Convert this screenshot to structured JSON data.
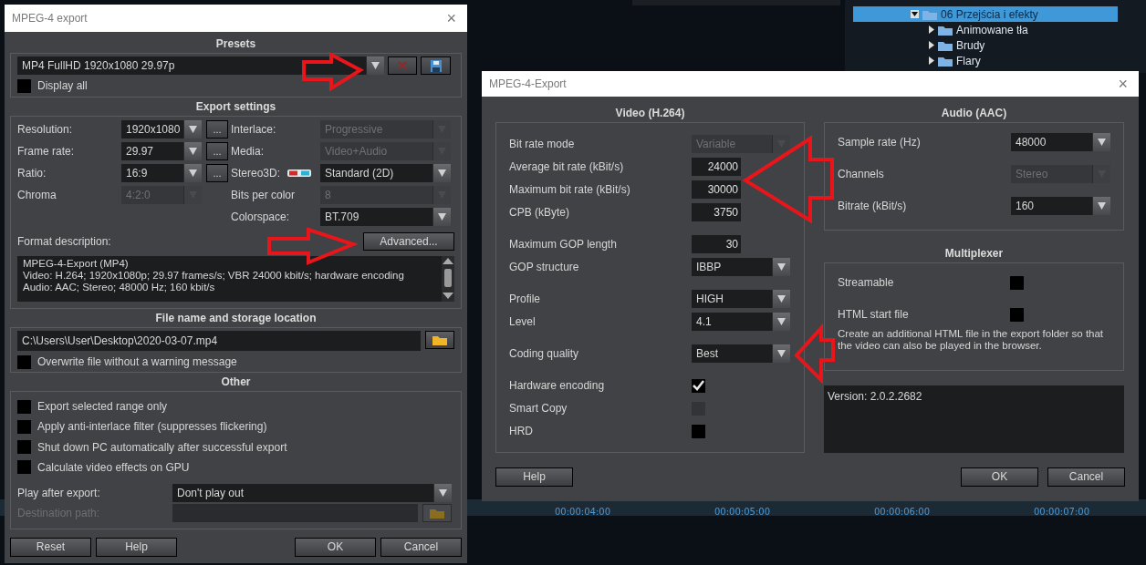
{
  "background": {
    "tree": {
      "items": [
        {
          "label": "06 Przejścia i efekty",
          "selected": true,
          "expanded": true,
          "children": [
            {
              "label": "Animowane tła",
              "selected": false
            },
            {
              "label": "Brudy",
              "selected": false
            },
            {
              "label": "Flary",
              "selected": false
            }
          ]
        }
      ]
    },
    "timeline": {
      "labels": [
        "00:00:04:00",
        "00:00:05:00",
        "00:00:06:00",
        "00:00:07:00"
      ]
    }
  },
  "export_dialog": {
    "title": "MPEG-4 export",
    "close": "×",
    "presets": {
      "title": "Presets",
      "preset": "MP4 FullHD 1920x1080 29.97p",
      "display_all": {
        "label": "Display all",
        "checked": false
      }
    },
    "export_settings": {
      "title": "Export settings",
      "left": [
        {
          "label": "Resolution:",
          "value": "1920x1080",
          "disabled": false,
          "more": "..."
        },
        {
          "label": "Frame rate:",
          "value": "29.97",
          "disabled": false,
          "more": "..."
        },
        {
          "label": "Ratio:",
          "value": "16:9",
          "disabled": false,
          "more": "..."
        },
        {
          "label": "Chroma",
          "value": "4:2:0",
          "disabled": true
        }
      ],
      "right": [
        {
          "label": "Interlace:",
          "value": "Progressive",
          "disabled": true,
          "kind": "select"
        },
        {
          "label": "Media:",
          "value": "Video+Audio",
          "disabled": true,
          "kind": "select"
        },
        {
          "label": "Stereo3D:",
          "value": "Standard (2D)",
          "disabled": false,
          "kind": "stereo"
        },
        {
          "label": "Bits per color",
          "value": "8",
          "disabled": true,
          "kind": "select"
        },
        {
          "label": "Colorspace:",
          "value": "BT.709",
          "disabled": false,
          "kind": "select"
        }
      ],
      "format_label": "Format description:",
      "advanced_button": "Advanced...",
      "description": [
        "MPEG-4-Export (MP4)",
        "Video: H.264; 1920x1080p; 29.97 frames/s; VBR 24000 kbit/s; hardware encoding",
        "Audio: AAC; Stereo; 48000 Hz; 160 kbit/s"
      ]
    },
    "file": {
      "title": "File name and storage location",
      "path": "C:\\Users\\User\\Desktop\\2020-03-07.mp4",
      "overwrite": {
        "label": "Overwrite file without a warning message",
        "checked": false
      }
    },
    "other": {
      "title": "Other",
      "options": [
        {
          "label": "Export selected range only",
          "checked": false
        },
        {
          "label": "Apply anti-interlace filter (suppresses flickering)",
          "checked": false
        },
        {
          "label": "Shut down PC automatically after successful export",
          "checked": false
        },
        {
          "label": "Calculate video effects on GPU",
          "checked": false
        }
      ],
      "play_label": "Play after export:",
      "play_value": "Don't play out",
      "destination_label": "Destination path:",
      "destination_disabled": true
    },
    "buttons": [
      "Reset",
      "Help",
      "OK",
      "Cancel"
    ]
  },
  "advanced_dialog": {
    "title": "MPEG-4-Export",
    "close": "×",
    "video": {
      "title": "Video (H.264)",
      "groups": [
        [
          {
            "label": "Bit rate mode",
            "kind": "select",
            "value": "Variable",
            "disabled": true
          },
          {
            "label": "Average bit rate (kBit/s)",
            "kind": "input",
            "value": "24000"
          },
          {
            "label": "Maximum bit rate (kBit/s)",
            "kind": "input",
            "value": "30000"
          },
          {
            "label": "CPB (kByte)",
            "kind": "input",
            "value": "3750"
          }
        ],
        [
          {
            "label": "Maximum GOP length",
            "kind": "input",
            "value": "30"
          },
          {
            "label": "GOP structure",
            "kind": "select",
            "value": "IBBP",
            "disabled": false
          }
        ],
        [
          {
            "label": "Profile",
            "kind": "select",
            "value": "HIGH",
            "disabled": false
          },
          {
            "label": "Level",
            "kind": "select",
            "value": "4.1",
            "disabled": false
          }
        ],
        [
          {
            "label": "Coding quality",
            "kind": "select",
            "value": "Best",
            "disabled": false
          }
        ],
        [
          {
            "label": "Hardware encoding",
            "kind": "checkbox",
            "checked": true,
            "disabled": false
          },
          {
            "label": "Smart Copy",
            "kind": "checkbox",
            "checked": false,
            "disabled": true
          },
          {
            "label": "HRD",
            "kind": "checkbox",
            "checked": false,
            "disabled": false
          }
        ]
      ]
    },
    "audio": {
      "title": "Audio (AAC)",
      "rows": [
        {
          "label": "Sample rate (Hz)",
          "value": "48000",
          "disabled": false
        },
        {
          "label": "Channels",
          "value": "Stereo",
          "disabled": true
        },
        {
          "label": "Bitrate (kBit/s)",
          "value": "160",
          "disabled": false
        }
      ]
    },
    "multiplexer": {
      "title": "Multiplexer",
      "options": [
        {
          "label": "Streamable",
          "checked": false
        },
        {
          "label": "HTML start file",
          "checked": false
        }
      ],
      "note": "Create an additional HTML file in the export folder so that the video can also be played in the browser."
    },
    "version": "Version: 2.0.2.2682",
    "buttons": [
      "Help",
      "OK",
      "Cancel"
    ]
  }
}
